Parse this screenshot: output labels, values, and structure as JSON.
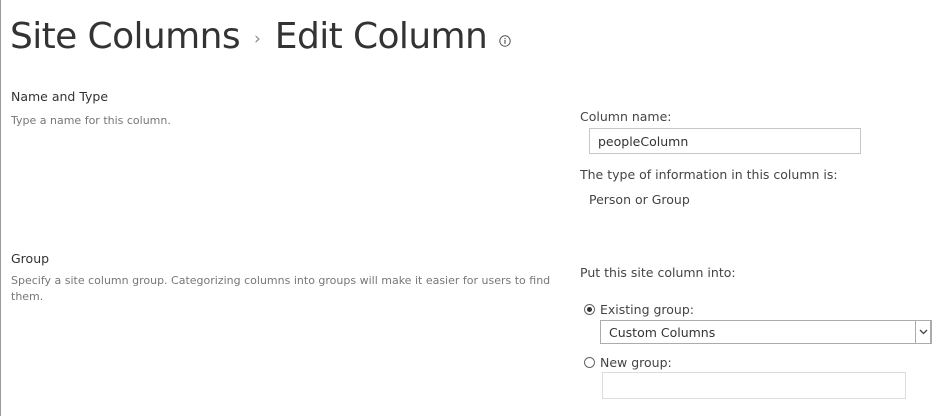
{
  "header": {
    "breadcrumb_parent": "Site Columns",
    "breadcrumb_separator": "›",
    "breadcrumb_current": "Edit Column",
    "info_icon": "info-icon"
  },
  "name_section": {
    "title": "Name and Type",
    "description": "Type a name for this column.",
    "column_name_label": "Column name:",
    "column_name_value": "peopleColumn",
    "type_label": "The type of information in this column is:",
    "type_value": "Person or Group"
  },
  "group_section": {
    "title": "Group",
    "description": "Specify a site column group. Categorizing columns into groups will make it easier for users to find them.",
    "put_into_label": "Put this site column into:",
    "existing_group_label": "Existing group:",
    "existing_group_selected": true,
    "existing_group_value": "Custom Columns",
    "new_group_label": "New group:",
    "new_group_selected": false,
    "new_group_value": ""
  }
}
